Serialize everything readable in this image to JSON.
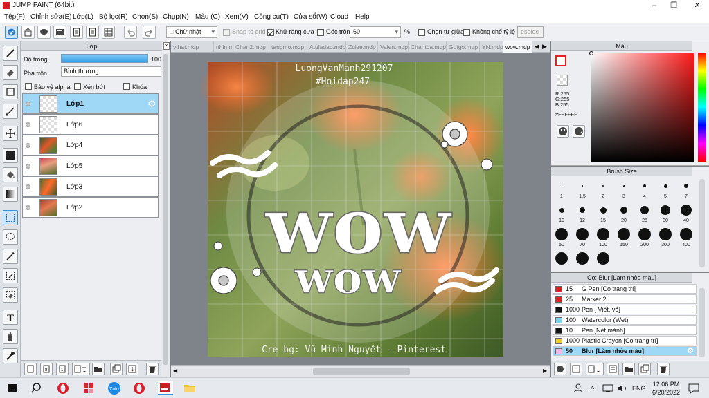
{
  "window": {
    "title": "JUMP PAINT (64bit)"
  },
  "menu": [
    "Tệp(F)",
    "Chỉnh sửa(E)",
    "Lớp(L)",
    "Bộ lọc(R)",
    "Chọn(S)",
    "Chụp(N)",
    "Màu (C)",
    "Xem(V)",
    "Công cụ(T)",
    "Cửa sổ(W)",
    "Cloud",
    "Help"
  ],
  "toolbar": {
    "shape_select": "Chữ nhật",
    "snap_grid": "Snap to grid",
    "antialias": "Khử răng cưa",
    "round_corner": "Góc tròn",
    "round_value": "60",
    "percent": "%",
    "center_select": "Chọn từ giữa",
    "fixed_ratio": "Không chế tỷ lệ",
    "deselect": "eselec"
  },
  "layer_panel": {
    "title": "Lớp",
    "opacity_label": "Độ trong",
    "opacity_value": "100 %",
    "opacity_fraction": 1.0,
    "blend_label": "Pha trộn",
    "blend_value": "Bình thường",
    "protect_alpha": "Bảo vệ alpha",
    "clip": "Xén bớt",
    "lock": "Khóa",
    "layers": [
      {
        "name": "Lớp1",
        "selected": true
      },
      {
        "name": "Lớp6",
        "selected": false
      },
      {
        "name": "Lớp4",
        "selected": false
      },
      {
        "name": "Lớp5",
        "selected": false
      },
      {
        "name": "Lớp3",
        "selected": false
      },
      {
        "name": "Lớp2",
        "selected": false
      }
    ]
  },
  "tabs": [
    "ythat.mdp",
    "nhin.mdp",
    "Chan2.mdp",
    "tangmo.mdp",
    "Atuladao.mdp",
    "Zuize.mdp",
    "Valen.mdp",
    "Chantoa.mdp",
    "Gutgo.mdp",
    "YN.mdp",
    "wow.mdp"
  ],
  "active_tab": "wow.mdp",
  "artwork": {
    "watermark_name": "LuongVanManh291207",
    "watermark_tag": "#Hoidap247",
    "word_big": "wow",
    "word_small": "wow",
    "credit": "Cre bg: Vũ Minh Nguyệt - Pinterest"
  },
  "color_panel": {
    "title": "Màu",
    "r": "R:255",
    "g": "G:255",
    "b": "B:255",
    "hex": "#FFFFFF",
    "accent": "#e02020"
  },
  "brush_size_panel": {
    "title": "Brush Size",
    "sizes": [
      "1",
      "1.5",
      "2",
      "3",
      "4",
      "5",
      "7",
      "10",
      "12",
      "15",
      "20",
      "25",
      "30",
      "40",
      "50",
      "70",
      "100",
      "150",
      "200",
      "300",
      "400",
      "",
      "",
      ""
    ]
  },
  "brush_list": {
    "title": "Cọ: Blur [Làm nhòe màu]",
    "items": [
      {
        "size": "15",
        "name": "G Pen [Cọ trang trí]",
        "color": "#e02020",
        "selected": false
      },
      {
        "size": "25",
        "name": "Marker 2",
        "color": "#e02020",
        "selected": false
      },
      {
        "size": "1000",
        "name": "Pen [ Viết, vẽ]",
        "color": "#111111",
        "selected": false
      },
      {
        "size": "100",
        "name": "Watercolor (Wet)",
        "color": "#7fd3f2",
        "selected": false
      },
      {
        "size": "10",
        "name": "Pen [Nét mảnh]",
        "color": "#111111",
        "selected": false
      },
      {
        "size": "1000",
        "name": "Plastic Crayon [Cọ trang trí]",
        "color": "#f0d020",
        "selected": false
      },
      {
        "size": "50",
        "name": "Blur [Làm nhòe màu]",
        "color": "#f2b8e8",
        "selected": true
      }
    ]
  },
  "taskbar": {
    "time": "12:06 PM",
    "date": "6/20/2022",
    "lang": "ENG"
  }
}
